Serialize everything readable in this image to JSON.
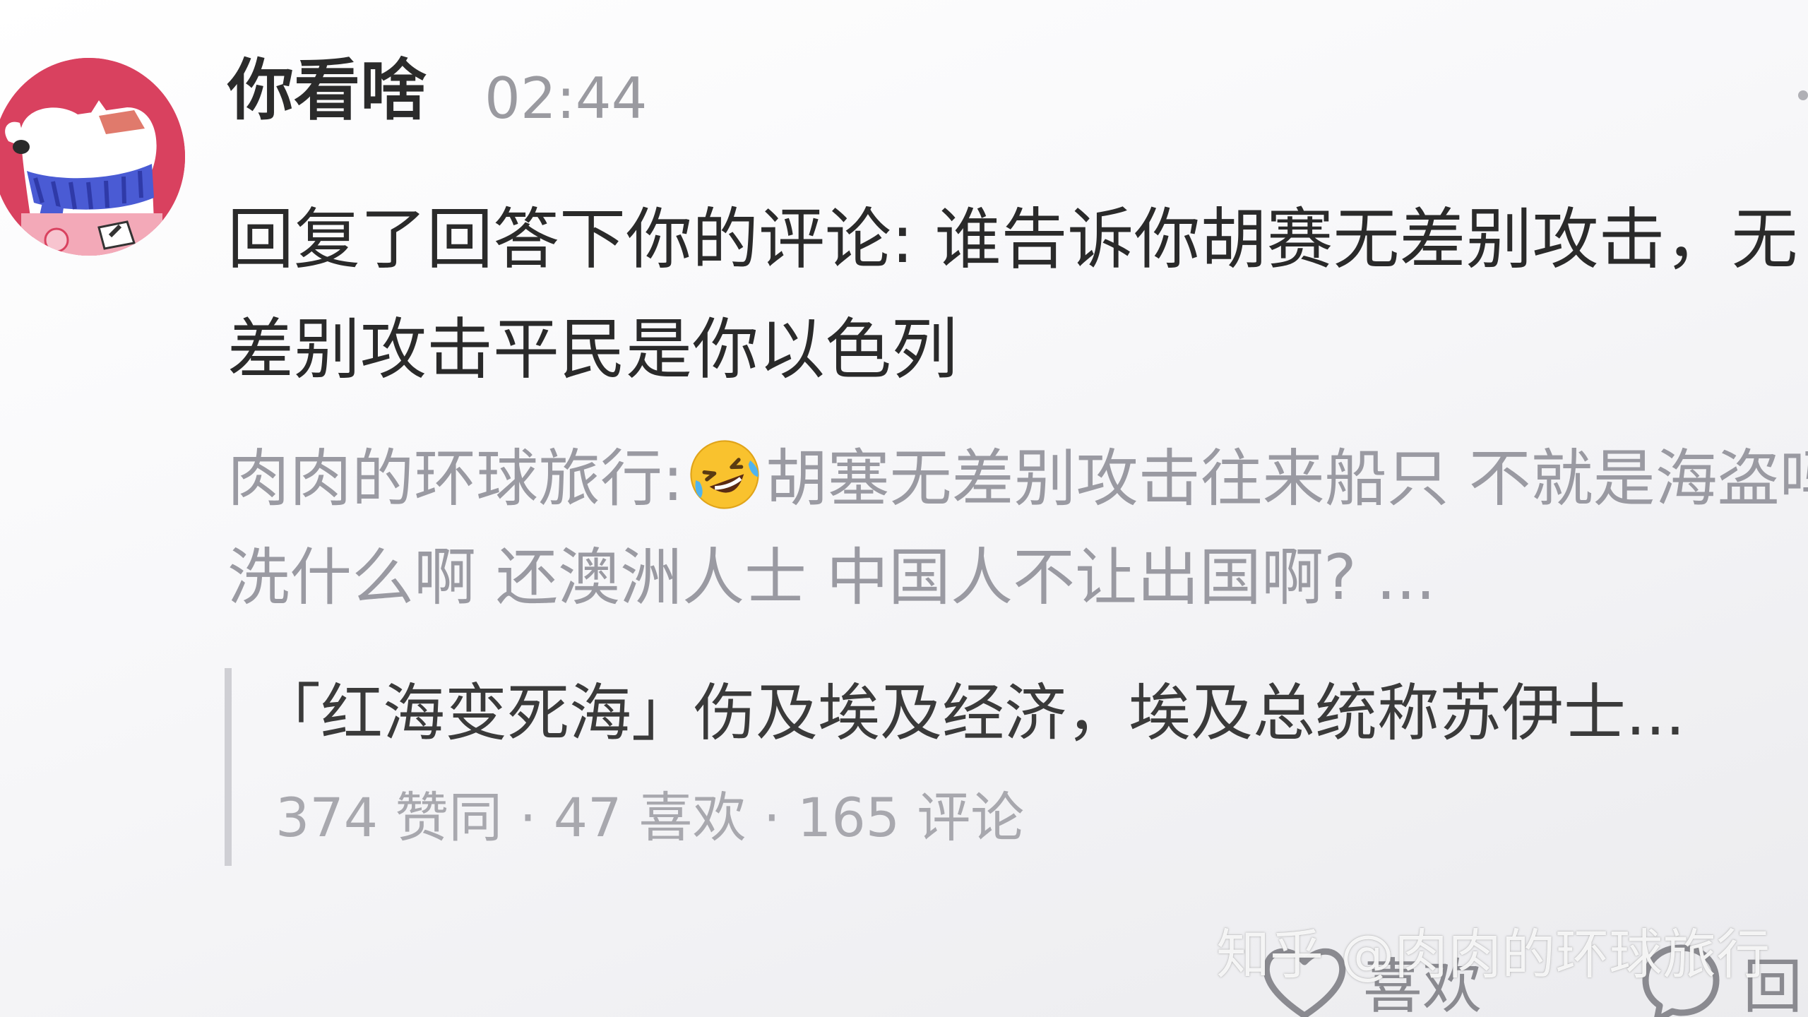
{
  "comment": {
    "username": "你看啥",
    "timestamp": "02:44",
    "reply_text": "回复了回答下你的评论: 谁告诉你胡赛无差别攻击，无差别攻击平民是你以色列",
    "quoted_author": "肉肉的环球旅行:",
    "quoted_emoji": "rolling-on-floor-laughing-emoji",
    "quoted_body": "胡塞无差别攻击往来船只 不就是海盗吗 洗什么啊 还澳洲人士 中国人不让出国啊? ..."
  },
  "reference": {
    "title": "「红海变死海」伤及埃及经济，埃及总统称苏伊士...",
    "stats": "374 赞同 · 47 喜欢 · 165 评论"
  },
  "actions": {
    "like_label": "喜欢",
    "reply_label": "回"
  },
  "watermark": "知乎 @肉肉的环球旅行",
  "colors": {
    "avatar_background": "#d9415f",
    "username": "#2b2b2b",
    "muted_text": "#9a9aa2"
  }
}
